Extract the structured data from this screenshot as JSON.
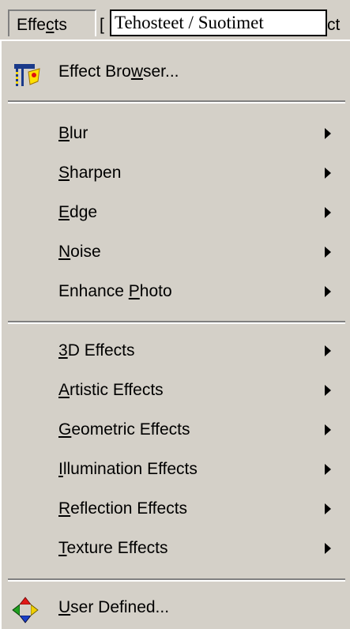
{
  "menubar": {
    "active_menu": "Effects",
    "next_menu_partial": "[",
    "next_menu_tail": "ct",
    "overlay_label": "Tehosteet / Suotimet"
  },
  "menu": {
    "groups": [
      {
        "items": [
          {
            "label_pre": "Effect Bro",
            "label_u": "w",
            "label_post": "ser...",
            "icon": "effect-browser-icon",
            "submenu": false
          }
        ]
      },
      {
        "items": [
          {
            "label_pre": "",
            "label_u": "B",
            "label_post": "lur",
            "submenu": true
          },
          {
            "label_pre": "",
            "label_u": "S",
            "label_post": "harpen",
            "submenu": true
          },
          {
            "label_pre": "",
            "label_u": "E",
            "label_post": "dge",
            "submenu": true
          },
          {
            "label_pre": "",
            "label_u": "N",
            "label_post": "oise",
            "submenu": true
          },
          {
            "label_pre": "Enhance ",
            "label_u": "P",
            "label_post": "hoto",
            "submenu": true
          }
        ]
      },
      {
        "items": [
          {
            "label_pre": "",
            "label_u": "3",
            "label_post": "D Effects",
            "submenu": true
          },
          {
            "label_pre": "",
            "label_u": "A",
            "label_post": "rtistic Effects",
            "submenu": true
          },
          {
            "label_pre": "",
            "label_u": "G",
            "label_post": "eometric Effects",
            "submenu": true
          },
          {
            "label_pre": "",
            "label_u": "I",
            "label_post": "llumination Effects",
            "submenu": true
          },
          {
            "label_pre": "",
            "label_u": "R",
            "label_post": "eflection Effects",
            "submenu": true
          },
          {
            "label_pre": "",
            "label_u": "T",
            "label_post": "exture Effects",
            "submenu": true
          }
        ]
      },
      {
        "items": [
          {
            "label_pre": "",
            "label_u": "U",
            "label_post": "ser Defined...",
            "icon": "user-defined-icon",
            "submenu": false
          }
        ]
      }
    ]
  },
  "colors": {
    "menu_bg": "#d4d0c8",
    "shadow": "#808080",
    "highlight": "#ffffff",
    "text": "#000000"
  }
}
